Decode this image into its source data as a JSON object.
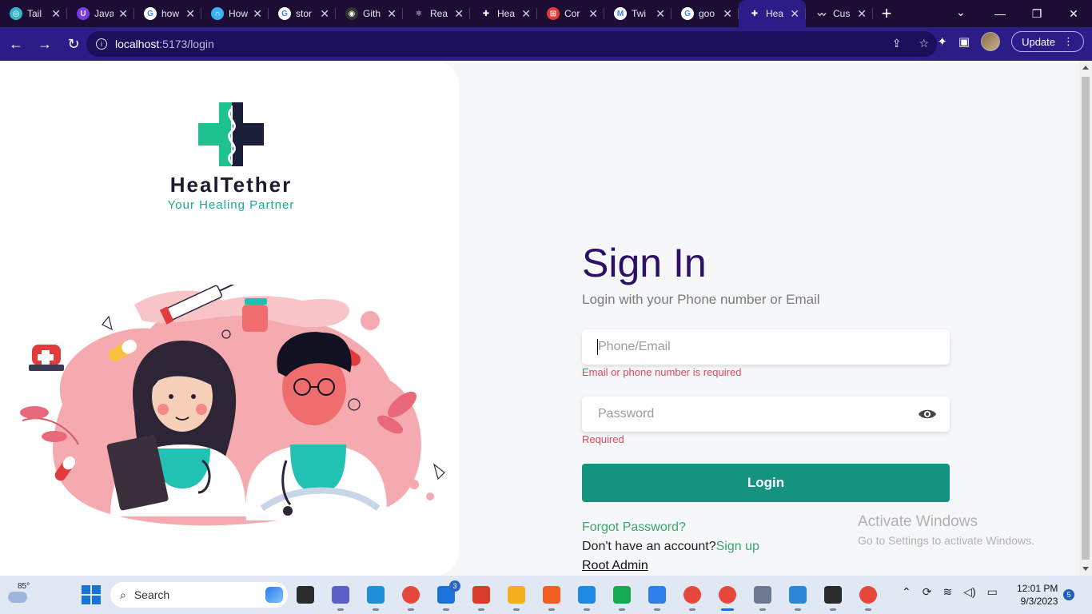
{
  "browser": {
    "tabs": [
      {
        "label": "Tail",
        "fav_color": "#2fb5c7",
        "fav_glyph": "◎"
      },
      {
        "label": "Java",
        "fav_color": "#7c3aed",
        "fav_glyph": "U"
      },
      {
        "label": "how",
        "fav_color": "#ffffff",
        "fav_glyph": "G"
      },
      {
        "label": "How",
        "fav_color": "#3db0f7",
        "fav_glyph": "∩"
      },
      {
        "label": "stor",
        "fav_color": "#ffffff",
        "fav_glyph": "G"
      },
      {
        "label": "Gith",
        "fav_color": "#333333",
        "fav_glyph": "◉"
      },
      {
        "label": "Rea",
        "fav_color": "#1b0d33",
        "fav_glyph": "⚛"
      },
      {
        "label": "Hea",
        "fav_color": "#1b0d33",
        "fav_glyph": "✚"
      },
      {
        "label": "Cor",
        "fav_color": "#e53935",
        "fav_glyph": "⊞"
      },
      {
        "label": "Twi",
        "fav_color": "#ffffff",
        "fav_glyph": "M"
      },
      {
        "label": "goo",
        "fav_color": "#ffffff",
        "fav_glyph": "G"
      },
      {
        "label": "Hea",
        "fav_color": "#2b1c88",
        "fav_glyph": "✚",
        "active": true
      },
      {
        "label": "Cus",
        "fav_color": "#1b0d33",
        "fav_glyph": "〰"
      }
    ],
    "url_host": "localhost",
    "url_path": ":5173/login",
    "update_label": "Update"
  },
  "brand": {
    "name": "HealTether",
    "tagline": "Your Healing Partner",
    "colors": {
      "green": "#1ec28f",
      "navy": "#1c1f3a"
    }
  },
  "form": {
    "title": "Sign In",
    "subtitle": "Login with your Phone number or Email",
    "identifier_placeholder": "Phone/Email",
    "identifier_error": "Email or phone number is required",
    "password_placeholder": "Password",
    "password_error": "Required",
    "login_label": "Login",
    "forgot_label": "Forgot Password?",
    "no_account_text": "Don't have an account?",
    "signup_label": "Sign up",
    "root_admin_label": "Root Admin",
    "accent": "#149480",
    "error_color": "#e2475b"
  },
  "watermark": {
    "line1": "Activate Windows",
    "line2": "Go to Settings to activate Windows."
  },
  "taskbar": {
    "temperature": "85°",
    "search_label": "Search",
    "time": "12:01 PM",
    "date": "9/3/2023",
    "notification_count": "5",
    "mail_badge": "3",
    "apps": [
      {
        "name": "task-view",
        "color": "#2b2b2b"
      },
      {
        "name": "meet",
        "color": "#5b5fc7"
      },
      {
        "name": "edge",
        "color": "#1f8fd8"
      },
      {
        "name": "chrome",
        "color": "#e8453c"
      },
      {
        "name": "mail",
        "color": "#1a73d9"
      },
      {
        "name": "wps",
        "color": "#d83b2a"
      },
      {
        "name": "files",
        "color": "#f2b01e"
      },
      {
        "name": "brave",
        "color": "#f25e21"
      },
      {
        "name": "vscode",
        "color": "#1e88e5"
      },
      {
        "name": "mongodb",
        "color": "#13aa52"
      },
      {
        "name": "notepad",
        "color": "#2d7ee8"
      },
      {
        "name": "chrome-profile",
        "color": "#e8453c"
      },
      {
        "name": "chrome-active",
        "color": "#e8453c"
      },
      {
        "name": "settings",
        "color": "#6b7a8f"
      },
      {
        "name": "paint",
        "color": "#2a87d8"
      },
      {
        "name": "terminal",
        "color": "#2b2b2b"
      },
      {
        "name": "chrome-2",
        "color": "#e8453c"
      }
    ]
  }
}
